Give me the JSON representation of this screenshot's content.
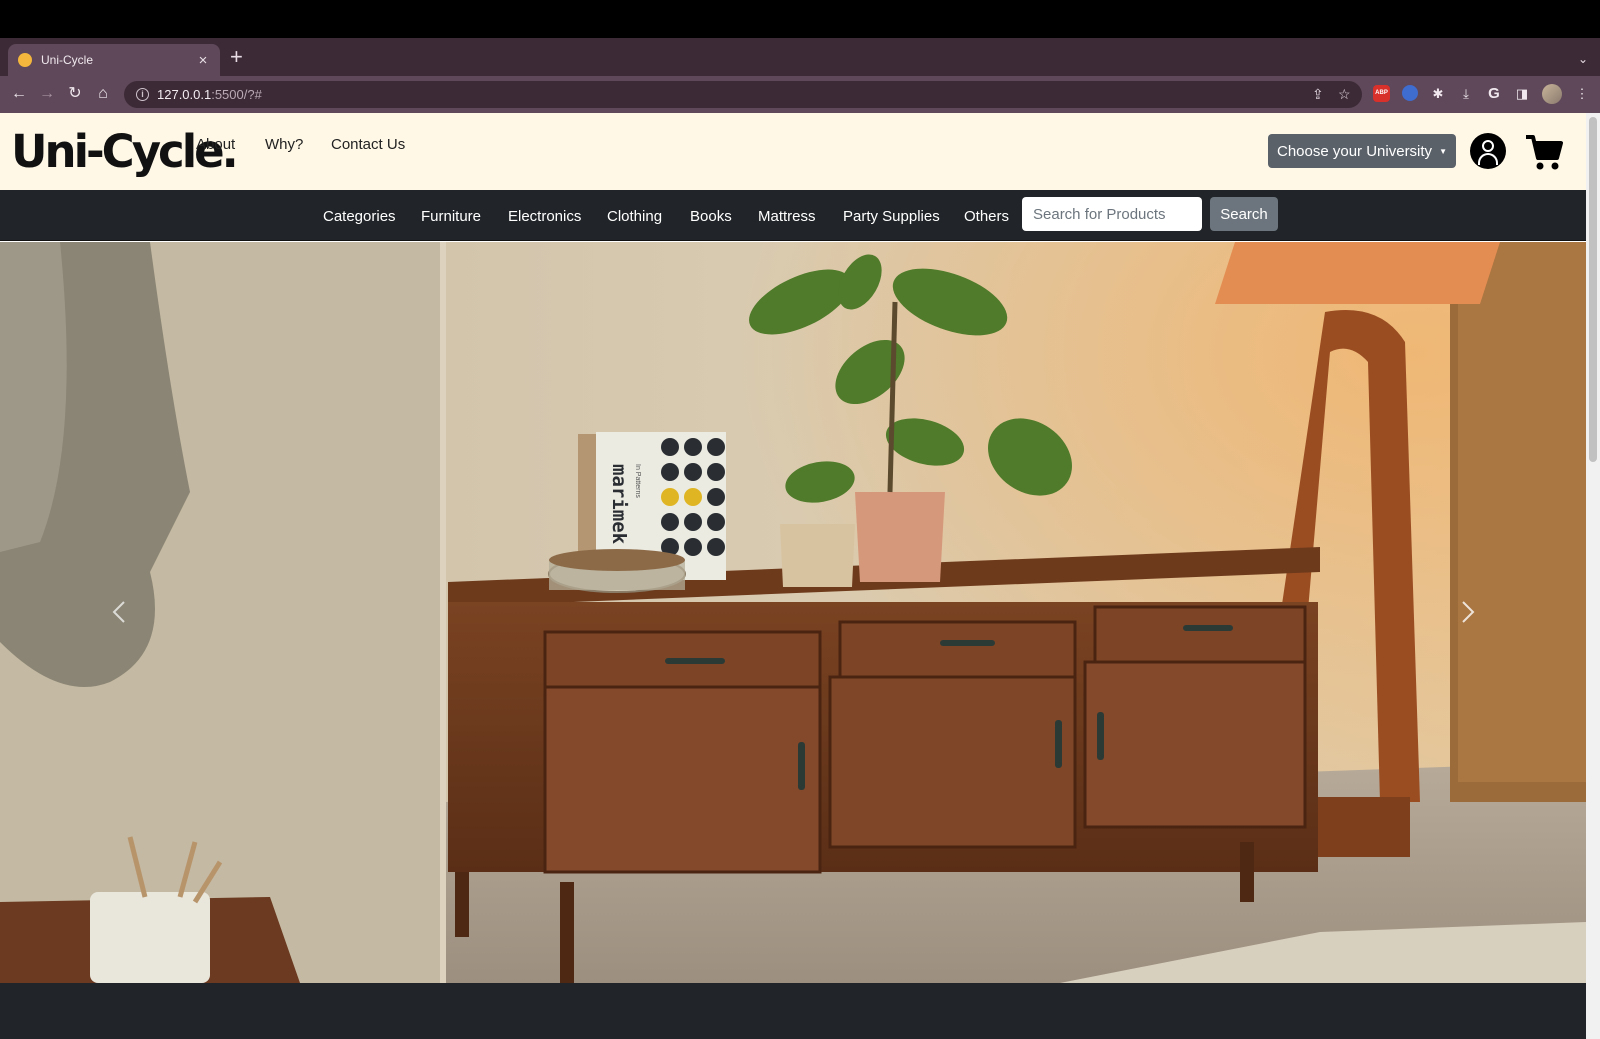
{
  "browser": {
    "tab_title": "Uni-Cycle",
    "tab_close": "×",
    "new_tab": "+",
    "url_host": "127.0.0.1",
    "url_rest": ":5500/?#"
  },
  "header": {
    "logo": "Uni-Cycle.",
    "links": [
      "About",
      "Why?",
      "Contact Us"
    ],
    "university_button": "Choose your University"
  },
  "catbar": {
    "items": [
      "Categories",
      "Furniture",
      "Electronics",
      "Clothing",
      "Books",
      "Mattress",
      "Party Supplies",
      "Others"
    ],
    "search_placeholder": "Search for Products",
    "search_button": "Search"
  },
  "hero": {
    "book_title": "marimek",
    "book_subtitle": "In Patterns"
  },
  "colors": {
    "header_bg": "#fff8e7",
    "catbar_bg": "#212529",
    "university_btn": "#5a6169",
    "search_btn": "#6c757d"
  }
}
